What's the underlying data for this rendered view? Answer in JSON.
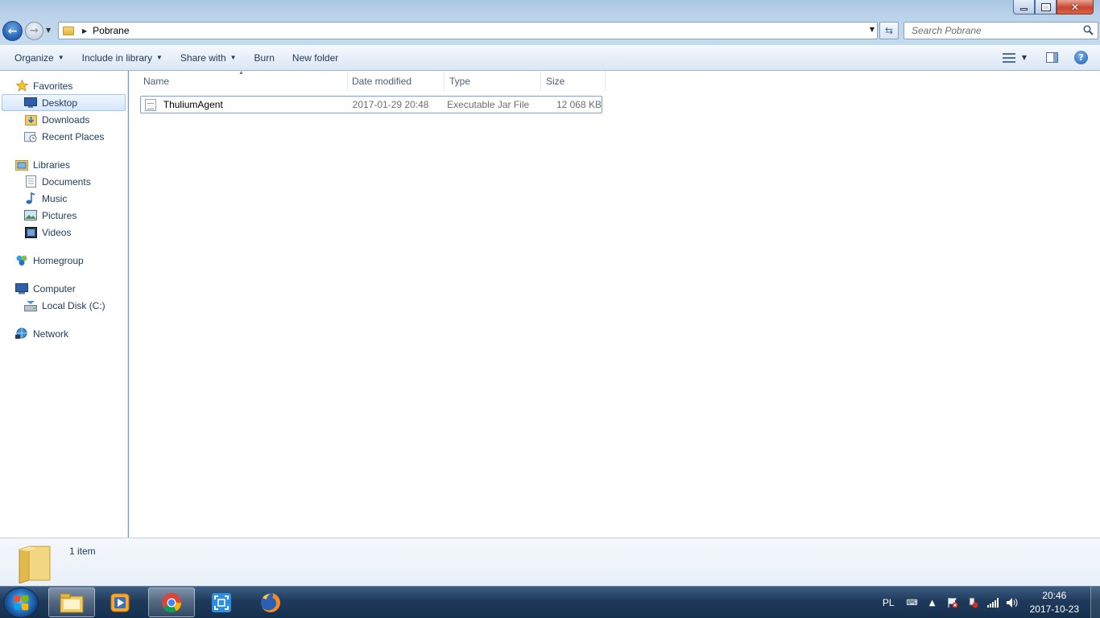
{
  "window": {
    "title_controls": {
      "minimize": "minimize",
      "maximize": "maximize",
      "close": "✕"
    }
  },
  "address": {
    "path": [
      "Pobrane"
    ],
    "current": "Pobrane"
  },
  "search": {
    "placeholder": "Search Pobrane"
  },
  "toolbar": {
    "organize": "Organize",
    "include_in_library": "Include in library",
    "share_with": "Share with",
    "burn": "Burn",
    "new_folder": "New folder"
  },
  "nav": {
    "favorites": {
      "label": "Favorites",
      "items": [
        {
          "label": "Desktop",
          "selected": true
        },
        {
          "label": "Downloads"
        },
        {
          "label": "Recent Places"
        }
      ]
    },
    "libraries": {
      "label": "Libraries",
      "items": [
        {
          "label": "Documents"
        },
        {
          "label": "Music"
        },
        {
          "label": "Pictures"
        },
        {
          "label": "Videos"
        }
      ]
    },
    "homegroup": {
      "label": "Homegroup"
    },
    "computer": {
      "label": "Computer",
      "items": [
        {
          "label": "Local Disk (C:)"
        }
      ]
    },
    "network": {
      "label": "Network"
    }
  },
  "columns": {
    "name": "Name",
    "date_modified": "Date modified",
    "type": "Type",
    "size": "Size"
  },
  "files": [
    {
      "name": "ThuliumAgent",
      "date_modified": "2017-01-29 20:48",
      "type": "Executable Jar File",
      "size": "12 068 KB"
    }
  ],
  "details": {
    "item_count": "1 item"
  },
  "taskbar": {
    "apps": [
      "windows-explorer",
      "media-player",
      "google-chrome",
      "screen-capture",
      "firefox"
    ],
    "tray": {
      "language": "PL",
      "time": "20:46",
      "date": "2017-10-23"
    }
  },
  "colors": {
    "accent": "#1e395b",
    "selection_border": "#7da2ce",
    "taskbar": "#1f3a5b"
  }
}
